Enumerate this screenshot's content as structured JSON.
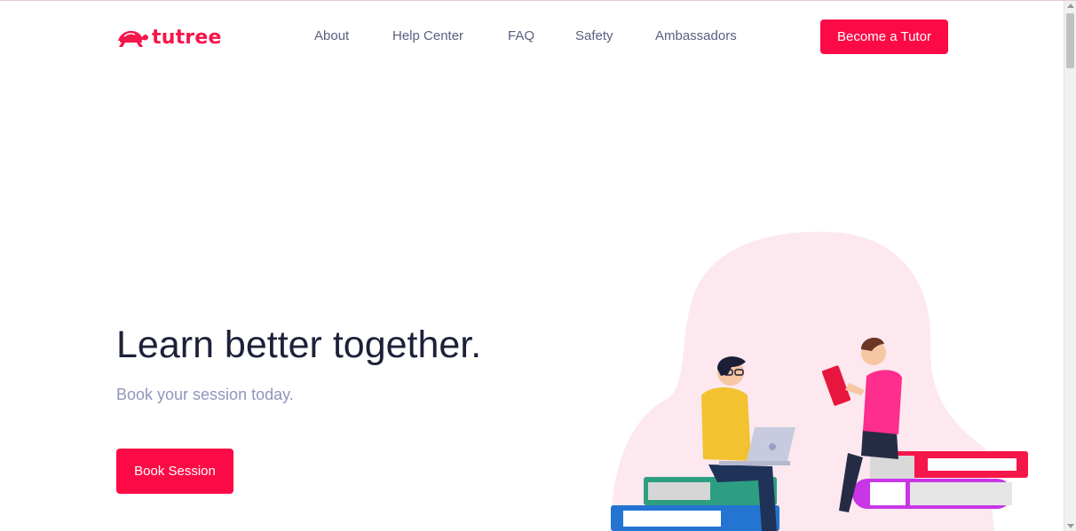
{
  "brand": {
    "name": "tutree",
    "accent": "#fc0a45"
  },
  "nav": {
    "links": [
      {
        "label": "About"
      },
      {
        "label": "Help Center"
      },
      {
        "label": "FAQ"
      },
      {
        "label": "Safety"
      },
      {
        "label": "Ambassadors"
      }
    ],
    "cta": "Become a Tutor"
  },
  "hero": {
    "title": "Learn better together.",
    "subtitle": "Book your session today.",
    "cta": "Book Session"
  },
  "icons": {
    "logo": "turtle-logo-icon"
  }
}
